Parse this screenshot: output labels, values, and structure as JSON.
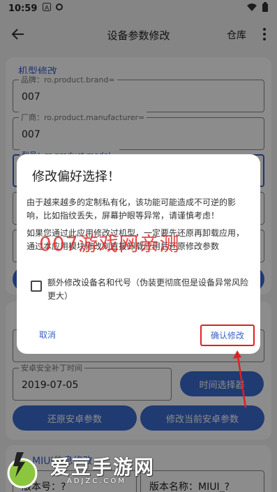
{
  "status_bar": {
    "time": "10:59",
    "left_icons": [
      "letter-a-icon",
      "settings-icon"
    ],
    "right_icons": [
      "wifi-icon",
      "battery-icon"
    ]
  },
  "app_bar": {
    "title": "设备参数修改",
    "action_label": "仓库"
  },
  "model_section": {
    "title": "机型修改",
    "brand": {
      "label": "品牌：ro.product.brand=",
      "value": "007"
    },
    "manufacturer": {
      "label": "厂商：ro.product.manufacturer=",
      "value": "007"
    },
    "model": {
      "label": "型号：ro.product.model="
    }
  },
  "android_section": {
    "patch": {
      "label": "安卓安全补丁时间",
      "value": "2019-07-05"
    },
    "time_picker_button": "时间选择器",
    "restore_button": "还原安卓参数",
    "apply_button": "修改当前安卓参数"
  },
  "miui_section": {
    "title": "MIUI信息修改",
    "version_no": "版本号：?",
    "version_name": "版本名称：MIUI_?"
  },
  "dialog": {
    "title": "修改偏好选择！",
    "para1": "由于越来越多的定制私有化，该功能可能造成不可逆的影响，比如指纹丢失，屏幕护眼等异常，请谨慎考虑！",
    "para2": "如果您通过此应用修改过机型，一定要先还原再卸载应用，通过本应用模块修改则直接卸载应用后还原修改参数",
    "checkbox_label": "额外修改设备名和代号（伪装更彻底但是设备异常风险更大）",
    "checkbox_checked": false,
    "cancel_label": "取消",
    "confirm_label": "确认修改"
  },
  "overlays": {
    "watermark_text": "007游戏网亲测",
    "logo_text": "爱豆手游网",
    "logo_sub": "ADJZC.COM"
  },
  "colors": {
    "accent": "#3b6ad0",
    "highlight": "#e02020"
  }
}
